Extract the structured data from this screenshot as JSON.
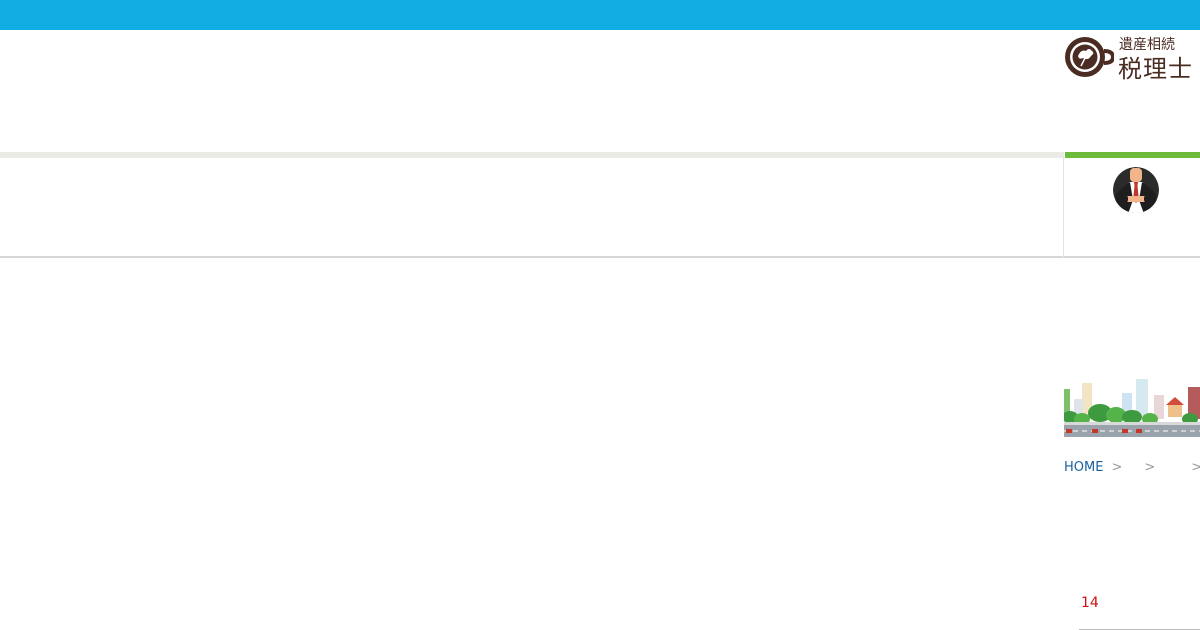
{
  "site": {
    "logo_small": "遺産相続",
    "logo_big": "税理士"
  },
  "nav": {
    "avatar_icon": "businessman-avatar-icon"
  },
  "breadcrumb": {
    "home": "HOME",
    "sep1": ">",
    "sep2": ">",
    "sep3": ">"
  },
  "content": {
    "count": "14"
  },
  "colors": {
    "topbar": "#10ade3",
    "accent_green": "#6dbb3a",
    "logo_brown": "#4a2c22",
    "count_red": "#d01010",
    "link_blue": "#1a5f9e"
  }
}
